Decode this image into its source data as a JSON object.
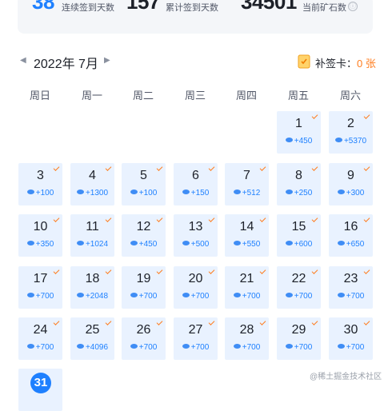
{
  "stats": {
    "continuous_days": "38",
    "continuous_label": "连续签到天数",
    "total_days": "157",
    "total_label": "累计签到天数",
    "ore": "34501",
    "ore_label": "当前矿石数",
    "info_icon": "ⓘ"
  },
  "calendar": {
    "month_title": "2022年 7月",
    "prev_icon": "◀",
    "next_icon": "▶",
    "card_label": "补签卡：",
    "card_count": "0 张"
  },
  "weekdays": [
    "周日",
    "周一",
    "周二",
    "周三",
    "周四",
    "周五",
    "周六"
  ],
  "days": [
    {
      "day": "1",
      "reward": "+450"
    },
    {
      "day": "2",
      "reward": "+5370"
    },
    {
      "day": "3",
      "reward": "+100"
    },
    {
      "day": "4",
      "reward": "+1300"
    },
    {
      "day": "5",
      "reward": "+100"
    },
    {
      "day": "6",
      "reward": "+150"
    },
    {
      "day": "7",
      "reward": "+512"
    },
    {
      "day": "8",
      "reward": "+250"
    },
    {
      "day": "9",
      "reward": "+300"
    },
    {
      "day": "10",
      "reward": "+350"
    },
    {
      "day": "11",
      "reward": "+1024"
    },
    {
      "day": "12",
      "reward": "+450"
    },
    {
      "day": "13",
      "reward": "+500"
    },
    {
      "day": "14",
      "reward": "+550"
    },
    {
      "day": "15",
      "reward": "+600"
    },
    {
      "day": "16",
      "reward": "+650"
    },
    {
      "day": "17",
      "reward": "+700"
    },
    {
      "day": "18",
      "reward": "+2048"
    },
    {
      "day": "19",
      "reward": "+700"
    },
    {
      "day": "20",
      "reward": "+700"
    },
    {
      "day": "21",
      "reward": "+700"
    },
    {
      "day": "22",
      "reward": "+700"
    },
    {
      "day": "23",
      "reward": "+700"
    },
    {
      "day": "24",
      "reward": "+700"
    },
    {
      "day": "25",
      "reward": "+4096"
    },
    {
      "day": "26",
      "reward": "+700"
    },
    {
      "day": "27",
      "reward": "+700"
    },
    {
      "day": "28",
      "reward": "+700"
    },
    {
      "day": "29",
      "reward": "+700"
    },
    {
      "day": "30",
      "reward": "+700"
    }
  ],
  "today": {
    "day": "31"
  },
  "watermark": "@稀土掘金技术社区",
  "colors": {
    "accent": "#1e80ff",
    "cell_bg": "#e9f2ff",
    "signed_tick": "#ff7d1f"
  }
}
